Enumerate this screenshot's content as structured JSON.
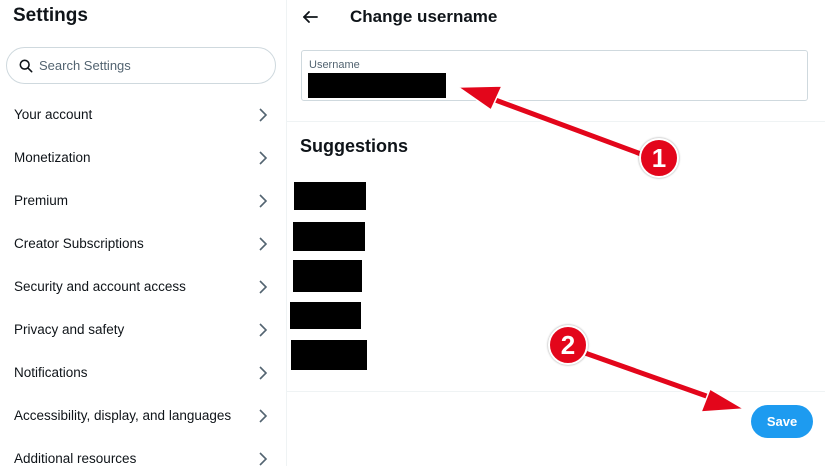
{
  "sidebar": {
    "title": "Settings",
    "search_placeholder": "Search Settings",
    "items": [
      {
        "label": "Your account"
      },
      {
        "label": "Monetization"
      },
      {
        "label": "Premium"
      },
      {
        "label": "Creator Subscriptions"
      },
      {
        "label": "Security and account access"
      },
      {
        "label": "Privacy and safety"
      },
      {
        "label": "Notifications"
      },
      {
        "label": "Accessibility, display, and languages"
      },
      {
        "label": "Additional resources"
      }
    ]
  },
  "main": {
    "title": "Change username",
    "username_label": "Username",
    "username_value": "",
    "suggestions_title": "Suggestions",
    "save_label": "Save"
  },
  "annotations": {
    "callout_1": "1",
    "callout_2": "2",
    "color": "#e3061b"
  },
  "colors": {
    "accent": "#1d9bf0",
    "text": "#0f1419",
    "muted": "#536471",
    "border": "#cfd9de"
  }
}
